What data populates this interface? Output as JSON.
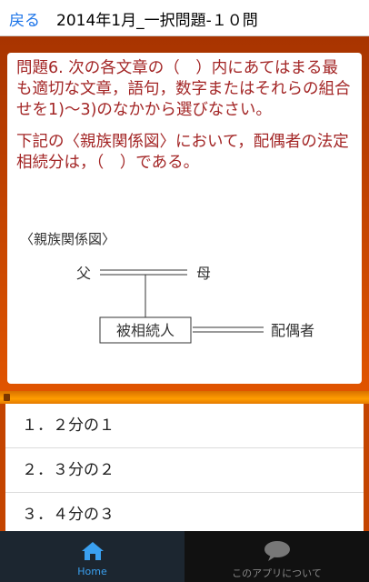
{
  "header": {
    "back_label": "戻る",
    "title": "2014年1月_一択問題-１０問"
  },
  "question": {
    "line1": "問題6. 次の各文章の（　）内にあてはまる最も適切な文章，語句，数字またはそれらの組合せを1)～3)のなかから選びなさい。",
    "line2": "下記の〈親族関係図〉において，配偶者の法定相続分は，（　）である。"
  },
  "diagram": {
    "caption": "〈親族関係図〉",
    "father": "父",
    "mother": "母",
    "deceased": "被相続人",
    "spouse": "配偶者"
  },
  "answers": [
    "１．２分の１",
    "２．３分の２",
    "３．４分の３"
  ],
  "tabs": {
    "home": "Home",
    "about": "このアプリについて"
  },
  "colors": {
    "accent": "#c44400",
    "question_text": "#a32626",
    "link": "#1a73e8"
  }
}
